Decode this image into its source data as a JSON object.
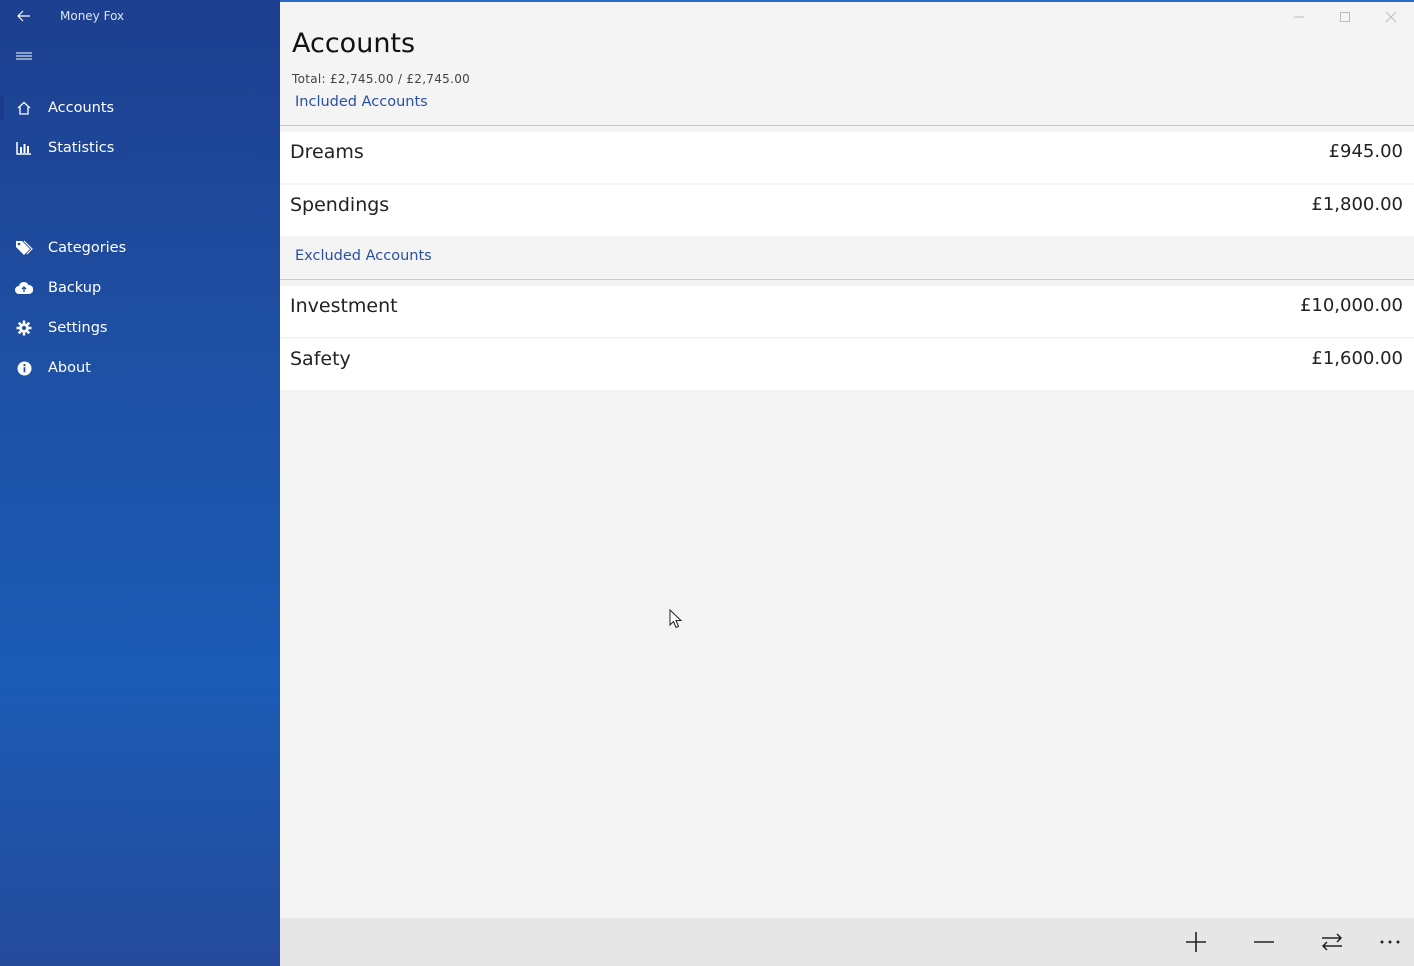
{
  "app": {
    "title": "Money Fox"
  },
  "sidebar": {
    "items": [
      {
        "label": "Accounts",
        "icon": "home-icon"
      },
      {
        "label": "Statistics",
        "icon": "bar-chart-icon"
      },
      {
        "label": "Categories",
        "icon": "tags-icon"
      },
      {
        "label": "Backup",
        "icon": "cloud-upload-icon"
      },
      {
        "label": "Settings",
        "icon": "gear-icon"
      },
      {
        "label": "About",
        "icon": "info-icon"
      }
    ]
  },
  "page": {
    "title": "Accounts",
    "total": "Total: £2,745.00  / £2,745.00"
  },
  "groups": {
    "included": {
      "label": "Included Accounts",
      "accounts": [
        {
          "name": "Dreams",
          "amount": "£945.00"
        },
        {
          "name": "Spendings",
          "amount": "£1,800.00"
        }
      ]
    },
    "excluded": {
      "label": "Excluded Accounts",
      "accounts": [
        {
          "name": "Investment",
          "amount": "£10,000.00"
        },
        {
          "name": "Safety",
          "amount": "£1,600.00"
        }
      ]
    }
  },
  "commandbar": {
    "buttons": [
      "add-icon",
      "minus-icon",
      "transfer-icon",
      "more-icon"
    ]
  },
  "colors": {
    "sidebar": "#1e4fa3",
    "accent": "#2a4fa0",
    "background": "#f4f4f4",
    "commandbar": "#e6e6e6"
  }
}
